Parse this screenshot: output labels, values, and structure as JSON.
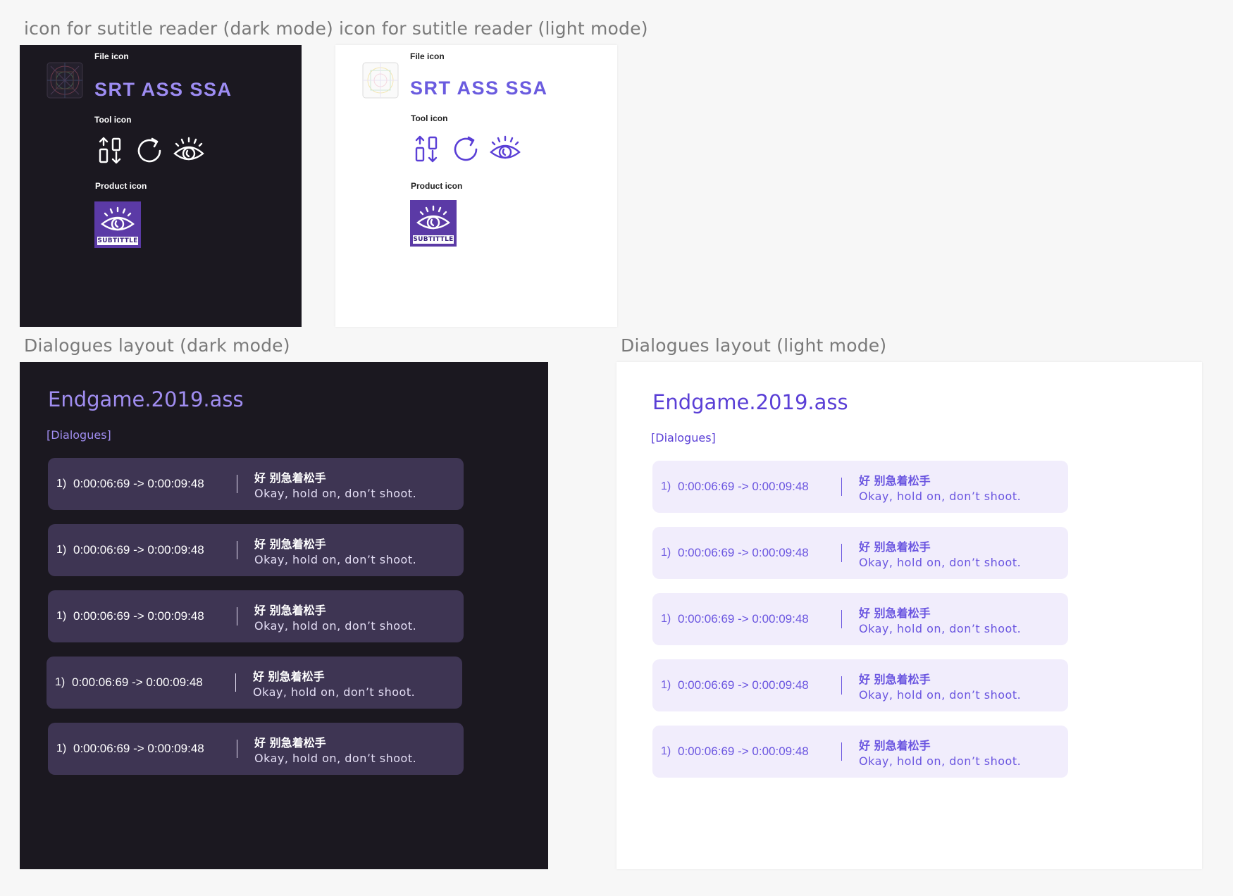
{
  "icon_frames": {
    "dark": {
      "label": "icon for sutitle reader (dark mode)",
      "file_icon_label": "File icon",
      "formats": "SRT ASS SSA",
      "tool_icon_label": "Tool icon",
      "tool_icons": [
        "sort-icon",
        "refresh-icon",
        "eye-icon"
      ],
      "product_icon_label": "Product icon",
      "product_badge_text": "SUBTITTLE"
    },
    "light": {
      "label": "icon for sutitle reader (light mode)",
      "file_icon_label": "File icon",
      "formats": "SRT ASS SSA",
      "tool_icon_label": "Tool icon",
      "tool_icons": [
        "sort-icon",
        "refresh-icon",
        "eye-icon"
      ],
      "product_icon_label": "Product icon",
      "product_badge_text": "SUBTITTLE"
    }
  },
  "dialogue_frames": {
    "dark": {
      "label": "Dialogues layout (dark mode)",
      "title": "Endgame.2019.ass",
      "section": "[Dialogues]",
      "items": [
        {
          "index": "1)",
          "time": "0:00:06:69 -> 0:00:09:48",
          "zh": "好 别急着松手",
          "en": "Okay, hold on, don’t shoot."
        },
        {
          "index": "1)",
          "time": "0:00:06:69 -> 0:00:09:48",
          "zh": "好 别急着松手",
          "en": "Okay, hold on, don’t shoot."
        },
        {
          "index": "1)",
          "time": "0:00:06:69 -> 0:00:09:48",
          "zh": "好 别急着松手",
          "en": "Okay, hold on, don’t shoot."
        },
        {
          "index": "1)",
          "time": "0:00:06:69 -> 0:00:09:48",
          "zh": "好 别急着松手",
          "en": "Okay, hold on, don’t shoot."
        },
        {
          "index": "1)",
          "time": "0:00:06:69 -> 0:00:09:48",
          "zh": "好 别急着松手",
          "en": "Okay, hold on, don’t shoot."
        }
      ]
    },
    "light": {
      "label": "Dialogues layout (light mode)",
      "title": "Endgame.2019.ass",
      "section": "[Dialogues]",
      "items": [
        {
          "index": "1)",
          "time": "0:00:06:69 -> 0:00:09:48",
          "zh": "好 别急着松手",
          "en": "Okay, hold on, don’t shoot."
        },
        {
          "index": "1)",
          "time": "0:00:06:69 -> 0:00:09:48",
          "zh": "好 别急着松手",
          "en": "Okay, hold on, don’t shoot."
        },
        {
          "index": "1)",
          "time": "0:00:06:69 -> 0:00:09:48",
          "zh": "好 别急着松手",
          "en": "Okay, hold on, don’t shoot."
        },
        {
          "index": "1)",
          "time": "0:00:06:69 -> 0:00:09:48",
          "zh": "好 别急着松手",
          "en": "Okay, hold on, don’t shoot."
        },
        {
          "index": "1)",
          "time": "0:00:06:69 -> 0:00:09:48",
          "zh": "好 别急着松手",
          "en": "Okay, hold on, don’t shoot."
        }
      ]
    }
  },
  "colors": {
    "canvas": "#f7f7f7",
    "dark_frame": "#1b1820",
    "dark_card": "#3e3553",
    "light_card": "#f1edfc",
    "accent_dark": "#a08df0",
    "accent_light": "#5a3fd6",
    "product_purple": "#5b3aa6"
  }
}
